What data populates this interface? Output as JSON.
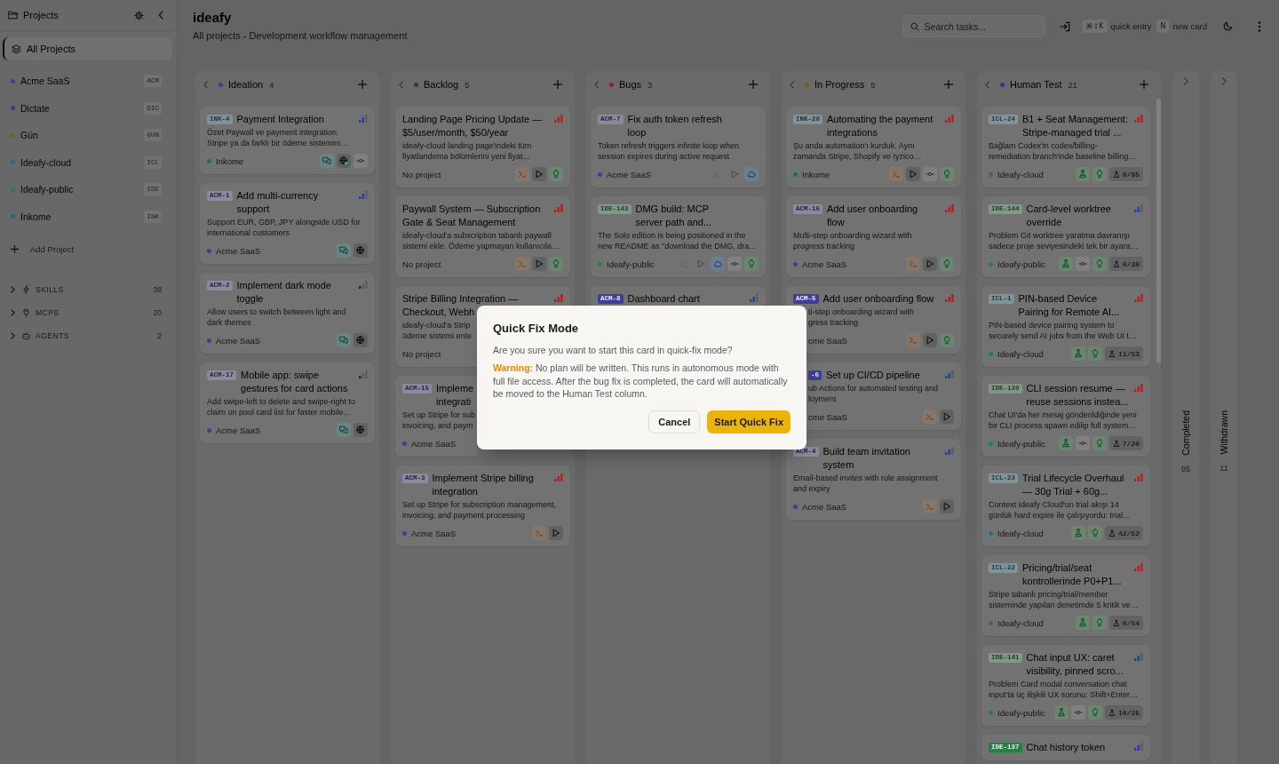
{
  "sidebar": {
    "title": "Projects",
    "all_projects": {
      "label": "All Projects",
      "selected": true
    },
    "projects": [
      {
        "name": "Acme SaaS",
        "code": "ACM",
        "color": "#403e96",
        "selected": false
      },
      {
        "name": "Dictate",
        "code": "DIC",
        "color": "#3c3a8c",
        "selected": false
      },
      {
        "name": "Gün",
        "code": "GUN",
        "color": "#7a5f1c",
        "selected": false
      },
      {
        "name": "Ideafy-cloud",
        "code": "ICL",
        "color": "#1e6f87",
        "selected": false
      },
      {
        "name": "Ideafy-public",
        "code": "IDE",
        "color": "#26803f",
        "selected": false
      },
      {
        "name": "Inkome",
        "code": "INK",
        "color": "#1d6a7c",
        "selected": false
      }
    ],
    "add_project": "Add Project",
    "sections": [
      {
        "kind": "skills",
        "label": "SKILLS",
        "count": "38",
        "expanded": false
      },
      {
        "kind": "mcps",
        "label": "MCPS",
        "count": "20",
        "expanded": false
      },
      {
        "kind": "agents",
        "label": "AGENTS",
        "count": "2",
        "expanded": false
      }
    ]
  },
  "header": {
    "title": "ideafy",
    "subtitle": "All projects - Development workflow management",
    "search": {
      "placeholder": "Search tasks..."
    },
    "shortcuts": [
      {
        "keys": "⌘⇧K",
        "label": "quick entry"
      },
      {
        "keys": "N",
        "label": "new card"
      }
    ]
  },
  "board": {
    "columns": [
      {
        "name": "Ideation",
        "count": "4",
        "color": "#403e96",
        "scrollbar": false,
        "cards": [
          {
            "kind": "full",
            "id": "INK-4",
            "title": "Payment Integration",
            "description": "Özet Paywall ve payment integration.\nStripe ya da farklı bir ödeme sistemini…",
            "project": "Inkome",
            "color": "#1d6a7c",
            "priority": {
              "kind": "medium"
            },
            "actions": [
              {
                "kind": "chat",
                "disabled": false
              },
              {
                "kind": "agent-done",
                "disabled": false
              },
              {
                "kind": "commit",
                "disabled": false
              }
            ]
          },
          {
            "kind": "full",
            "id": "ACM-1",
            "title": "Add multi-currency\nsupport",
            "description": "Support EUR, GBP, JPY alongside USD for\ninternational customers",
            "project": "Acme SaaS",
            "color": "#403e96",
            "priority": {
              "kind": "medium"
            },
            "actions": [
              {
                "kind": "chat",
                "disabled": false
              },
              {
                "kind": "agent",
                "disabled": false
              }
            ]
          },
          {
            "kind": "full",
            "id": "ACM-2",
            "title": "Implement dark mode\ntoggle",
            "description": "Allow users to switch between light and\ndark themes",
            "project": "Acme SaaS",
            "color": "#403e96",
            "priority": {
              "kind": "low"
            },
            "actions": [
              {
                "kind": "chat",
                "disabled": false
              },
              {
                "kind": "agent",
                "disabled": false
              }
            ]
          },
          {
            "kind": "full",
            "id": "ACM-17",
            "title": "Mobile app: swipe\ngestures for card actions",
            "description": "Add swipe-left to delete and swipe-right to\nclaim on pool card list for faster mobile…",
            "project": "Acme SaaS",
            "color": "#403e96",
            "priority": {
              "kind": "low"
            },
            "actions": [
              {
                "kind": "chat",
                "disabled": false
              },
              {
                "kind": "agent",
                "disabled": false
              }
            ]
          }
        ]
      },
      {
        "name": "Backlog",
        "count": "5",
        "color": "#33384a",
        "scrollbar": false,
        "cards": [
          {
            "kind": "full",
            "title": "Landing Page Pricing Update —\n$5/user/month, $50/year",
            "description": "ideafy-cloud landing page'indeki tüm\nfiyatlandırma bölümlerini yeni fiyat…",
            "project": "No project",
            "priority": {
              "kind": "high"
            },
            "actions": [
              {
                "kind": "terminal",
                "disabled": false
              },
              {
                "kind": "play",
                "disabled": false
              },
              {
                "kind": "idea",
                "disabled": false
              }
            ]
          },
          {
            "kind": "full",
            "title": "Paywall System — Subscription\nGate & Seat Management",
            "description": "ideafy-cloud'a subscription tabanlı paywall\nsistemi ekle. Ödeme yapmayan kullanıcıla…",
            "project": "No project",
            "priority": {
              "kind": "high"
            },
            "actions": [
              {
                "kind": "terminal",
                "disabled": false
              },
              {
                "kind": "play",
                "disabled": false
              },
              {
                "kind": "idea",
                "disabled": false
              }
            ]
          },
          {
            "kind": "full",
            "title": "Stripe Billing Integration —\nCheckout, Webh",
            "description": "ideafy-cloud'a Strip\nödeme sistemi ente",
            "project": "No project",
            "priority": {
              "kind": "high"
            }
          },
          {
            "kind": "clipped-right",
            "id": "ACM-15",
            "title": "Impleme\nintegrati",
            "description": "Set up Stripe for sub\ninvoicing, and paym",
            "project": "Acme SaaS",
            "color": "#403e96"
          },
          {
            "kind": "full",
            "id": "ACM-3",
            "title": "Implement Stripe billing\nintegration",
            "description": "Set up Stripe for subscription management,\ninvoicing, and payment processing",
            "project": "Acme SaaS",
            "color": "#403e96",
            "priority": {
              "kind": "high"
            },
            "actions": [
              {
                "kind": "terminal",
                "disabled": false
              },
              {
                "kind": "play",
                "disabled": false
              }
            ]
          }
        ]
      },
      {
        "name": "Bugs",
        "count": "3",
        "color": "#8d2424",
        "scrollbar": false,
        "cards": [
          {
            "kind": "full",
            "id": "ACM-7",
            "title": "Fix auth token refresh\nloop",
            "description": "Token refresh triggers infinite loop when\nsession expires during active request",
            "project": "Acme SaaS",
            "color": "#403e96",
            "actions": [
              {
                "kind": "terminal",
                "disabled": true
              },
              {
                "kind": "play",
                "disabled": true
              },
              {
                "kind": "cloud",
                "disabled": false
              }
            ]
          },
          {
            "kind": "full",
            "id": "IDE-143",
            "title": "DMG build: MCP\nserver path and...",
            "description": "The Solo edition is being positioned in the\nnew README as \"download the DMG, dra…",
            "project": "Ideafy-public",
            "color": "#26803f",
            "actions": [
              {
                "kind": "terminal",
                "disabled": true
              },
              {
                "kind": "play",
                "disabled": true
              },
              {
                "kind": "cloud",
                "disabled": false
              },
              {
                "kind": "commit",
                "disabled": false
              },
              {
                "kind": "idea",
                "disabled": false
              }
            ]
          },
          {
            "kind": "full",
            "id": "ACM-8",
            "title": "Dashboard chart",
            "color": "#403e96",
            "priority": {
              "kind": "medium"
            }
          }
        ]
      },
      {
        "name": "In Progress",
        "count": "5",
        "color": "#7d5c14",
        "scrollbar": false,
        "cards": [
          {
            "kind": "full",
            "id": "INK-28",
            "title": "Automating the payment\nintegrations",
            "description": "Şu anda automation'ı kurduk. Aynı\nzamanda Stripe, Shopify ve Iyzico…",
            "project": "Inkome",
            "color": "#1d6a7c",
            "priority": {
              "kind": "high"
            },
            "actions": [
              {
                "kind": "terminal",
                "disabled": false
              },
              {
                "kind": "play",
                "disabled": false
              },
              {
                "kind": "commit",
                "disabled": false
              },
              {
                "kind": "idea",
                "disabled": false
              }
            ]
          },
          {
            "kind": "full",
            "id": "ACM-16",
            "title": "Add user onboarding\nflow",
            "description": "Multi-step onboarding wizard with\nprogress tracking",
            "project": "Acme SaaS",
            "color": "#403e96",
            "priority": {
              "kind": "high"
            },
            "actions": [
              {
                "kind": "terminal",
                "disabled": false
              },
              {
                "kind": "play",
                "disabled": false
              },
              {
                "kind": "idea",
                "disabled": false
              }
            ]
          },
          {
            "kind": "clipped-body",
            "id": "ACM-5",
            "title": "Add user onboarding flow",
            "description": "ti-step onboarding wizard with\ngress tracking",
            "project": "cme SaaS",
            "color": "#403e96",
            "priority": {
              "kind": "high"
            },
            "actions": [
              {
                "kind": "terminal",
                "disabled": false
              },
              {
                "kind": "play",
                "disabled": false
              },
              {
                "kind": "idea",
                "disabled": false
              }
            ]
          },
          {
            "kind": "clipped",
            "id": "-6",
            "title": "Set up CI/CD pipeline",
            "description": "ub Actions for automated testing and\nloyment",
            "project": "cme SaaS",
            "color": "#403e96",
            "priority": {
              "kind": "medium"
            },
            "actions": [
              {
                "kind": "terminal",
                "disabled": false
              },
              {
                "kind": "play",
                "disabled": false
              }
            ]
          },
          {
            "kind": "full",
            "id": "ACM-4",
            "title": "Build team invitation\nsystem",
            "description": "Email-based invites with role assignment\nand expiry",
            "project": "Acme SaaS",
            "color": "#403e96",
            "priority": {
              "kind": "medium"
            },
            "actions": [
              {
                "kind": "terminal",
                "disabled": false
              },
              {
                "kind": "play",
                "disabled": false
              }
            ]
          }
        ]
      },
      {
        "name": "Human Test",
        "count": "21",
        "color": "#22408f",
        "scrollbar": true,
        "cards": [
          {
            "kind": "full",
            "id": "ICL-24",
            "title": "B1 + Seat Management:\nStripe-managed trial ...",
            "description": "Bağlam Codex'in codex/billing-\nremediation branch'inde baseline billing…",
            "project": "Ideafy-cloud",
            "color": "#1e6f87",
            "priority": {
              "kind": "high"
            },
            "actions": [
              {
                "kind": "flask",
                "disabled": false
              },
              {
                "kind": "idea",
                "disabled": false
              }
            ],
            "tests": "0/95"
          },
          {
            "kind": "full",
            "id": "IDE-144",
            "title": "Card-level worktree\noverride",
            "description": "Problem Git worktree yaratma davranışı\nsadece proje seviyesindeki tek bir ayara…",
            "project": "Ideafy-public",
            "color": "#26803f",
            "priority": {
              "kind": "medium"
            },
            "actions": [
              {
                "kind": "flask",
                "disabled": false
              },
              {
                "kind": "commit",
                "disabled": false
              },
              {
                "kind": "idea",
                "disabled": false
              }
            ],
            "tests": "0/30"
          },
          {
            "kind": "full",
            "id": "ICL-1",
            "title": "PIN-based Device\nPairing for Remote AI...",
            "description": "PIN-based device pairing system to\nsecurely send AI jobs from the Web UI t…",
            "project": "Ideafy-cloud",
            "color": "#1e6f87",
            "priority": {
              "kind": "high"
            },
            "actions": [
              {
                "kind": "flask",
                "disabled": false
              },
              {
                "kind": "idea",
                "disabled": false
              }
            ],
            "tests": "11/53"
          },
          {
            "kind": "full",
            "id": "IDE-139",
            "title": "CLI session resume —\nreuse sessions instea...",
            "description": "Chat UI'da her mesaj gönderildiğinde yeni\nbir CLI process spawn edilip full system…",
            "project": "Ideafy-public",
            "color": "#26803f",
            "priority": {
              "kind": "high"
            },
            "actions": [
              {
                "kind": "flask",
                "disabled": false
              },
              {
                "kind": "commit",
                "disabled": false
              },
              {
                "kind": "idea",
                "disabled": false
              }
            ],
            "tests": "7/20"
          },
          {
            "kind": "full",
            "id": "ICL-23",
            "title": "Trial Lifecycle Overhaul\n— 30g Trial + 60g...",
            "description": "Context Ideafy Cloud'un trial akışı 14\ngünlük hard expire ile çalışıyordu: trial…",
            "project": "Ideafy-cloud",
            "color": "#1e6f87",
            "priority": {
              "kind": "high"
            },
            "actions": [
              {
                "kind": "flask",
                "disabled": false
              },
              {
                "kind": "idea",
                "disabled": false
              }
            ],
            "tests": "42/52"
          },
          {
            "kind": "full",
            "id": "ICL-22",
            "title": "Pricing/trial/seat\nkontrollerinde P0+P1...",
            "description": "Stripe tabanlı pricing/trial/member\nsisteminde yapılan denetimde 5 kritik ve…",
            "project": "Ideafy-cloud",
            "color": "#1e6f87",
            "priority": {
              "kind": "high"
            },
            "actions": [
              {
                "kind": "flask",
                "disabled": false
              },
              {
                "kind": "idea",
                "disabled": false
              }
            ],
            "tests": "0/54"
          },
          {
            "kind": "full",
            "id": "IDE-141",
            "title": "Chat input UX: caret\nvisibility, pinned scro...",
            "description": "Problem Card modal conversation chat\ninput'ta üç ilişkili UX sorunu: Shift+Enter…",
            "project": "Ideafy-public",
            "color": "#26803f",
            "priority": {
              "kind": "medium"
            },
            "actions": [
              {
                "kind": "flask",
                "disabled": false
              },
              {
                "kind": "commit",
                "disabled": false
              },
              {
                "kind": "idea",
                "disabled": false
              }
            ],
            "tests": "10/25"
          },
          {
            "kind": "full",
            "id": "IDE-137",
            "title": "Chat history token",
            "color": "#26803f",
            "priority": {
              "kind": "medium"
            }
          }
        ]
      }
    ],
    "collapsed_columns": [
      {
        "name": "Completed",
        "count": "95"
      },
      {
        "name": "Withdrawn",
        "count": "11"
      }
    ]
  },
  "dialog": {
    "title": "Quick Fix Mode",
    "message": "Are you sure you want to start this card in quick-fix mode?",
    "warning": "**Warning:** No plan will be written. This runs in autonomous mode with full file access. After the bug fix is completed, the card will automatically be moved to the Human Test column.",
    "buttons": [
      {
        "kind": "cancel",
        "label": "Cancel"
      },
      {
        "kind": "confirm",
        "label": "Start Quick Fix"
      }
    ]
  }
}
